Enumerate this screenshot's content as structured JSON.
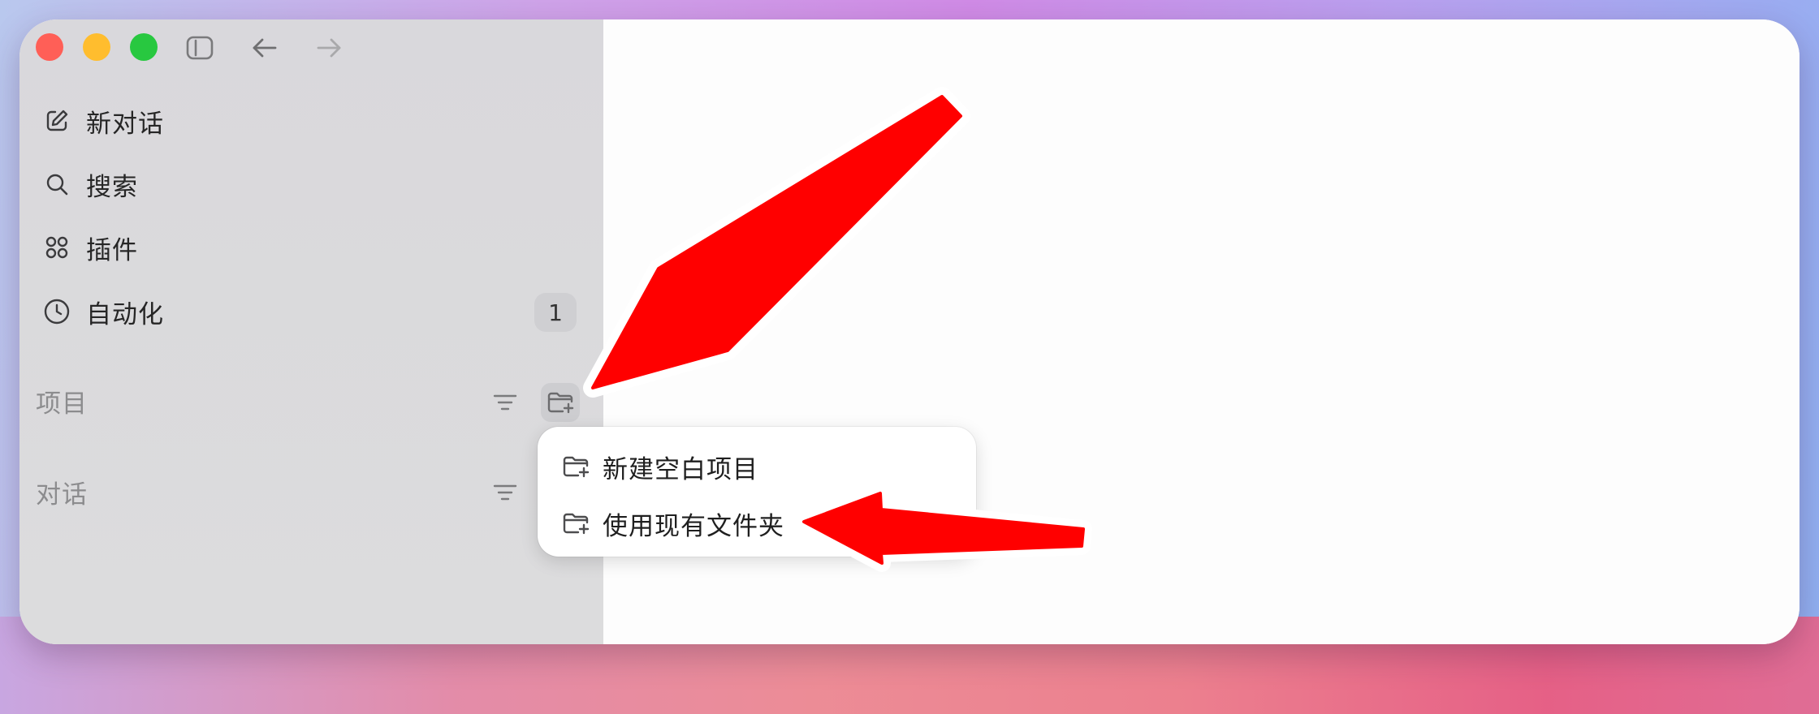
{
  "window": {
    "traffic_lights": [
      "close",
      "minimize",
      "maximize"
    ],
    "toolbar": {
      "sidebar_toggle_icon": "sidebar-toggle-icon",
      "back_icon": "arrow-left-icon",
      "forward_icon": "arrow-right-icon"
    }
  },
  "sidebar": {
    "nav": [
      {
        "label": "新对话",
        "icon": "compose-icon"
      },
      {
        "label": "搜索",
        "icon": "search-icon"
      },
      {
        "label": "插件",
        "icon": "grid-icon"
      },
      {
        "label": "自动化",
        "icon": "clock-icon",
        "badge": "1"
      }
    ],
    "sections": {
      "projects": {
        "title": "项目"
      },
      "conversations": {
        "title": "对话"
      }
    }
  },
  "menu": {
    "items": [
      {
        "label": "新建空白项目",
        "icon": "folder-plus-icon"
      },
      {
        "label": "使用现有文件夹",
        "icon": "folder-plus-icon"
      }
    ]
  },
  "colors": {
    "sidebar_bg": "#d9d9db",
    "accent_arrow": "#ff0000",
    "close": "#ff5f57",
    "minimize": "#ffbd2e",
    "maximize": "#28c840"
  }
}
